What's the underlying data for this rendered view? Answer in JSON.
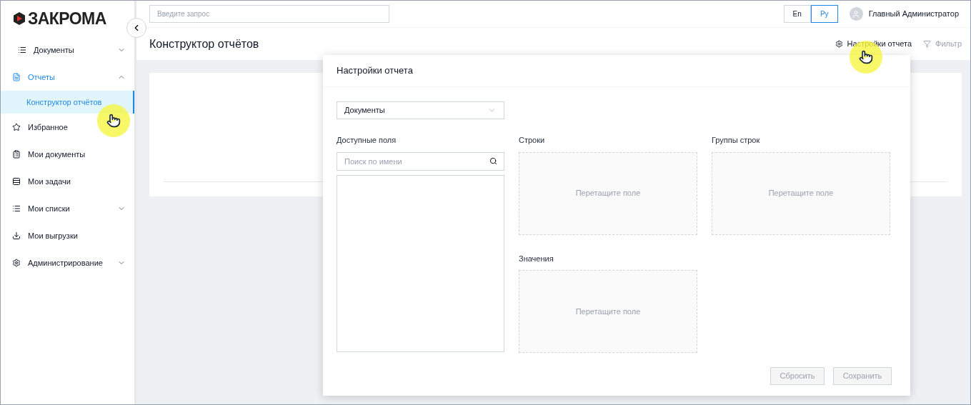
{
  "logo": {
    "text": "ЗАКРОМА"
  },
  "search": {
    "placeholder": "Введите запрос"
  },
  "languages": [
    {
      "label": "En",
      "selected": false
    },
    {
      "label": "Ру",
      "selected": true
    }
  ],
  "user": {
    "name": "Главный Администратор"
  },
  "page": {
    "title": "Конструктор отчётов",
    "actions": [
      {
        "label": "Настройки отчета",
        "disabled": false
      },
      {
        "label": "Фильтр",
        "disabled": true
      }
    ]
  },
  "sidebar": {
    "items": [
      {
        "label": "Документы",
        "selected": false,
        "expanded": false
      },
      {
        "label": "Отчеты",
        "selected": true,
        "expanded": true,
        "children": [
          {
            "label": "Конструктор отчётов",
            "selected": true
          }
        ]
      },
      {
        "label": "Избранное",
        "selected": false
      },
      {
        "label": "Мои документы",
        "selected": false
      },
      {
        "label": "Мои задачи",
        "selected": false
      },
      {
        "label": "Мои списки",
        "selected": false,
        "expanded": false
      },
      {
        "label": "Мои выгрузки",
        "selected": false
      },
      {
        "label": "Администрирование",
        "selected": false,
        "expanded": false
      }
    ]
  },
  "dialog": {
    "title": "Настройки отчета",
    "source": {
      "value": "Документы"
    },
    "available": {
      "label": "Доступные поля",
      "search_placeholder": "Поиск по имени"
    },
    "zones": [
      {
        "label": "Строки",
        "hint": "Перетащите поле"
      },
      {
        "label": "Группы строк",
        "hint": "Перетащите поле"
      },
      {
        "label": "Значения",
        "hint": "Перетащите поле"
      }
    ],
    "buttons": [
      {
        "label": "Сбросить",
        "disabled": true
      },
      {
        "label": "Сохранить",
        "disabled": true
      }
    ]
  }
}
